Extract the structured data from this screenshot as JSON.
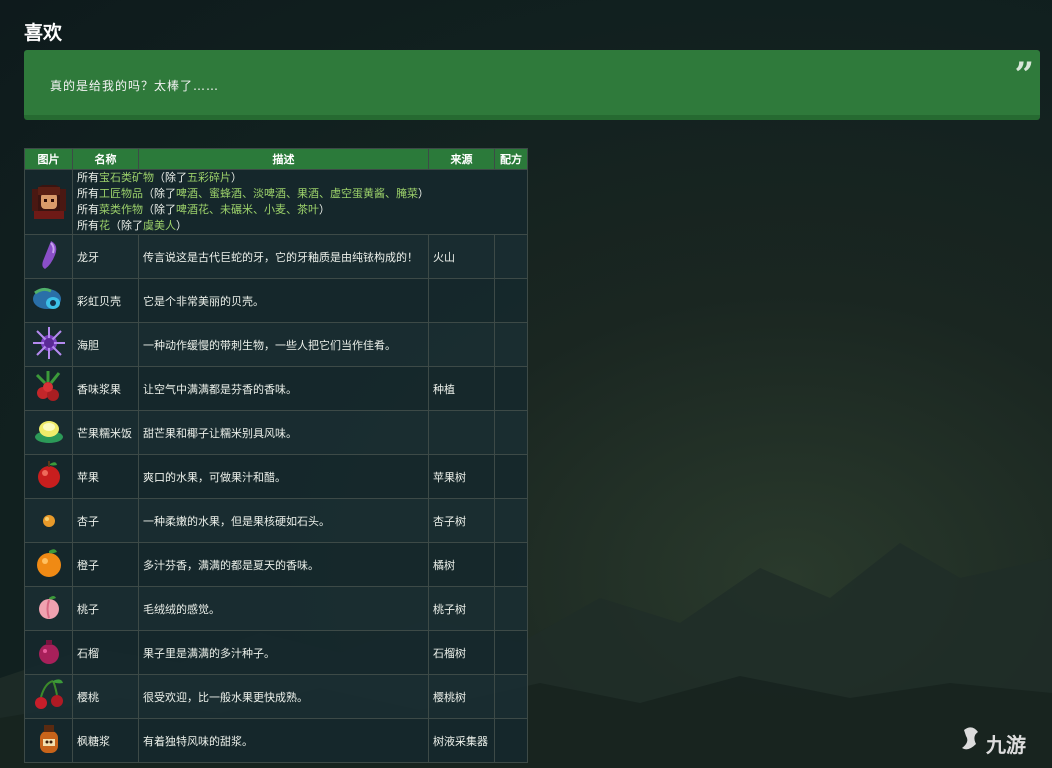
{
  "heading": "喜欢",
  "quote": {
    "text": "真的是给我的吗？太棒了……",
    "mark": "”"
  },
  "table": {
    "headers": [
      "图片",
      "名称",
      "描述",
      "来源",
      "配方"
    ],
    "general": {
      "line1": {
        "prefix": "所有",
        "link": "宝石类矿物",
        "mid": "（除了",
        "link2": "五彩碎片",
        "end": "）"
      },
      "line2": {
        "prefix": "所有",
        "link": "工匠物品",
        "mid": "（除了",
        "items": "啤酒、蜜蜂酒、淡啤酒、果酒、虚空蛋黄酱、腌菜",
        "end": "）"
      },
      "line3": {
        "prefix": "所有",
        "link": "菜类作物",
        "mid": "（除了",
        "items": "啤酒花、未碾米、小麦、茶叶",
        "end": "）"
      },
      "line4": {
        "prefix": "所有",
        "link": "花",
        "mid": "（除了",
        "items": "虞美人",
        "end": "）"
      }
    },
    "rows": [
      {
        "name": "龙牙",
        "desc": "传言说这是古代巨蛇的牙，它的牙釉质是由纯铱构成的！",
        "source": "火山",
        "icon": "dragon-tooth-icon"
      },
      {
        "name": "彩虹贝壳",
        "desc": "它是个非常美丽的贝壳。",
        "source": "",
        "icon": "rainbow-shell-icon"
      },
      {
        "name": "海胆",
        "desc": "一种动作缓慢的带刺生物，一些人把它们当作佳肴。",
        "source": "",
        "icon": "sea-urchin-icon"
      },
      {
        "name": "香味浆果",
        "desc": "让空气中满满都是芬香的香味。",
        "source": "种植",
        "icon": "berry-icon"
      },
      {
        "name": "芒果糯米饭",
        "desc": "甜芒果和椰子让糯米别具风味。",
        "source": "",
        "icon": "mango-rice-icon"
      },
      {
        "name": "苹果",
        "desc": "爽口的水果，可做果汁和醋。",
        "source": "苹果树",
        "icon": "apple-icon"
      },
      {
        "name": "杏子",
        "desc": "一种柔嫩的水果，但是果核硬如石头。",
        "source": "杏子树",
        "icon": "apricot-icon"
      },
      {
        "name": "橙子",
        "desc": "多汁芬香，满满的都是夏天的香味。",
        "source": "橘树",
        "icon": "orange-icon"
      },
      {
        "name": "桃子",
        "desc": "毛绒绒的感觉。",
        "source": "桃子树",
        "icon": "peach-icon"
      },
      {
        "name": "石榴",
        "desc": "果子里是满满的多汁种子。",
        "source": "石榴树",
        "icon": "pomegranate-icon"
      },
      {
        "name": "樱桃",
        "desc": "很受欢迎，比一般水果更快成熟。",
        "source": "樱桃树",
        "icon": "cherry-icon"
      },
      {
        "name": "枫糖浆",
        "desc": "有着独特风味的甜浆。",
        "source": "树液采集器",
        "icon": "maple-syrup-icon"
      }
    ]
  },
  "watermark": "九游",
  "colors": {
    "accent": "#2f7a3b",
    "link": "#9bd06a",
    "header": "#2b7a3a"
  }
}
